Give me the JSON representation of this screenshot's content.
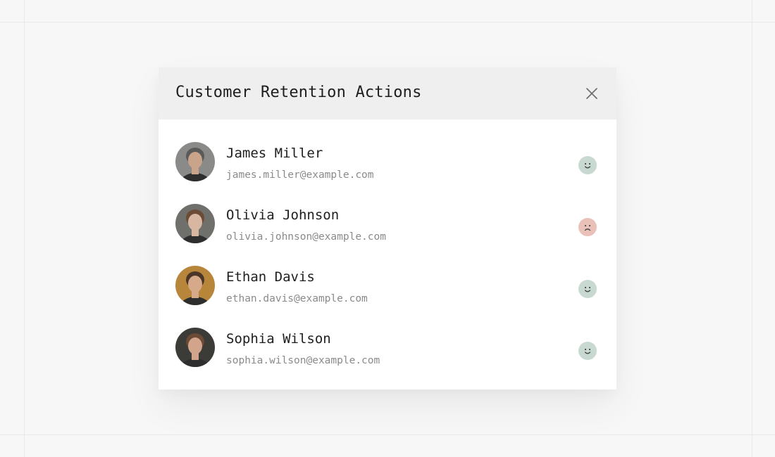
{
  "modal": {
    "title": "Customer Retention Actions"
  },
  "customers": [
    {
      "name": "James Miller",
      "email": "james.miller@example.com",
      "sentiment": "happy",
      "sentiment_color": "#c7d9d0",
      "avatar_bg": "#8a8a88",
      "avatar_skin": "#c9a48a",
      "avatar_hair": "#5a5a58"
    },
    {
      "name": "Olivia Johnson",
      "email": "olivia.johnson@example.com",
      "sentiment": "sad",
      "sentiment_color": "#eac1b9",
      "avatar_bg": "#6f6f6c",
      "avatar_skin": "#d8b7a2",
      "avatar_hair": "#6b4a36"
    },
    {
      "name": "Ethan Davis",
      "email": "ethan.davis@example.com",
      "sentiment": "happy",
      "sentiment_color": "#c7d9d0",
      "avatar_bg": "#b8863a",
      "avatar_skin": "#d6a98a",
      "avatar_hair": "#4a3526"
    },
    {
      "name": "Sophia Wilson",
      "email": "sophia.wilson@example.com",
      "sentiment": "happy",
      "sentiment_color": "#c7d9d0",
      "avatar_bg": "#3b3b38",
      "avatar_skin": "#d2a48c",
      "avatar_hair": "#6b4a36"
    }
  ],
  "icons": {
    "close": "close-icon",
    "happy": "smile-icon",
    "sad": "frown-icon"
  }
}
